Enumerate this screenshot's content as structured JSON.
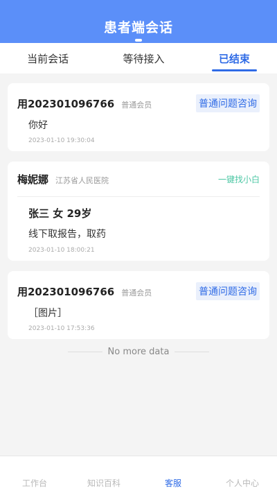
{
  "header": {
    "title": "患者端会话"
  },
  "tabs": [
    {
      "label": "当前会话"
    },
    {
      "label": "等待接入"
    },
    {
      "label": "已结束"
    }
  ],
  "sessions": [
    {
      "name": "用202301096766",
      "member": "普通会员",
      "tag": "普通问题咨询",
      "message": "你好",
      "time": "2023-01-10 19:30:04"
    },
    {
      "name": "梅妮娜",
      "hospital": "江苏省人民医院",
      "action": "一键找小白",
      "patient": "张三 女 29岁",
      "message": "线下取报告，取药",
      "time": "2023-01-10 18:00:21"
    },
    {
      "name": "用202301096766",
      "member": "普通会员",
      "tag": "普通问题咨询",
      "message": "［图片］",
      "time": "2023-01-10 17:53:36"
    }
  ],
  "list_end": "No more data",
  "tabbar": [
    {
      "label": "工作台"
    },
    {
      "label": "知识百科"
    },
    {
      "label": "客服"
    },
    {
      "label": "个人中心"
    }
  ],
  "colors": {
    "header": "#5b8ff9",
    "accent": "#2f6be6",
    "green_tag": "#4cc7a4"
  }
}
